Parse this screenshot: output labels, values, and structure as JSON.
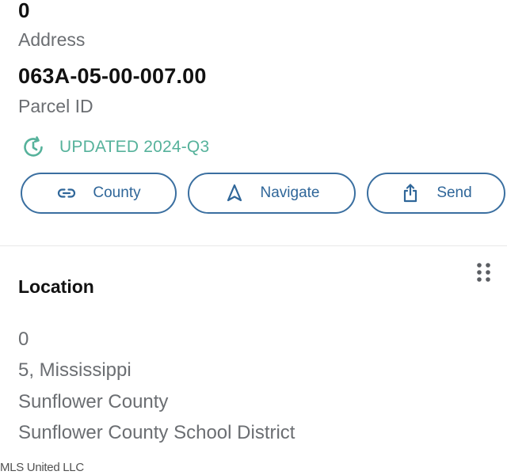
{
  "property": {
    "address_value": "0",
    "address_label": "Address",
    "parcel_value": "063A-05-00-007.00",
    "parcel_label": "Parcel ID",
    "updated_text": "UPDATED 2024-Q3"
  },
  "actions": [
    {
      "label": "County",
      "icon": "link-icon"
    },
    {
      "label": "Navigate",
      "icon": "navigation-arrow-icon"
    },
    {
      "label": "Send",
      "icon": "share-icon"
    }
  ],
  "location": {
    "title": "Location",
    "lines": [
      "0",
      "5, Mississippi",
      "Sunflower County",
      "Sunflower County School District"
    ]
  },
  "watermark": "MLS United LLC",
  "colors": {
    "accent_green": "#56b29b",
    "button_blue": "#2f6699",
    "muted_text": "#6b6e72"
  }
}
